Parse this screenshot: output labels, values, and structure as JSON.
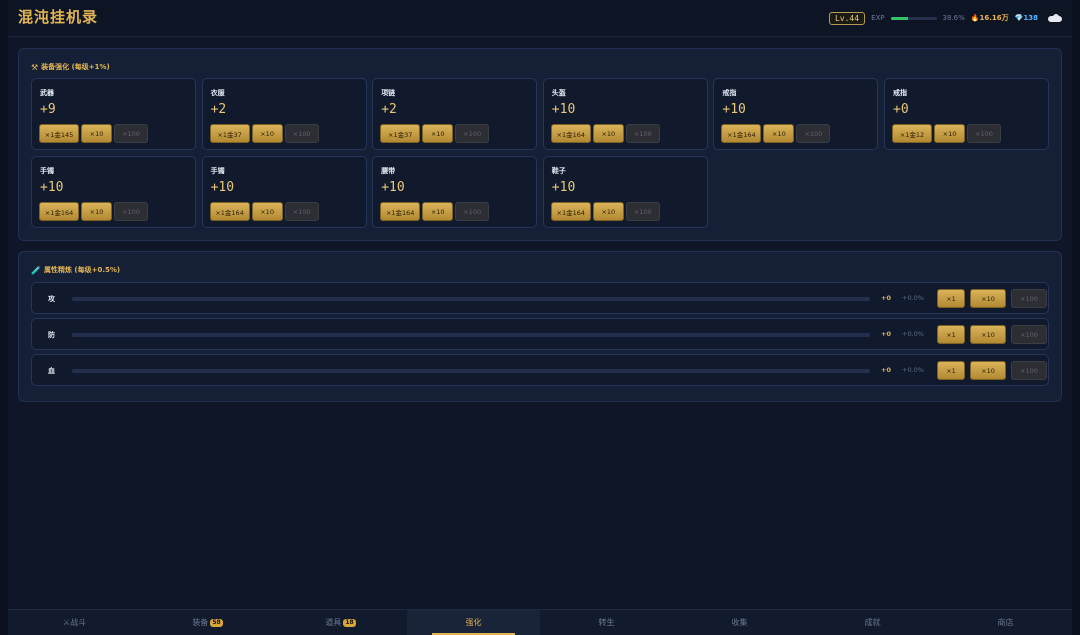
{
  "app": {
    "title": "混沌挂机录"
  },
  "header": {
    "level": "Lv.44",
    "exp_label": "EXP",
    "exp_progress": 0.386,
    "exp_pct": "38.6%",
    "gold": "16.16万",
    "gems": "138",
    "colors": {
      "accent": "#e2b554",
      "exp": "#34c36b",
      "gem": "#58b3ff"
    }
  },
  "equip": {
    "title": "装备强化 (每级+1%)",
    "icon": "hammer-pick-icon",
    "items": [
      {
        "name": "武器",
        "level": "+9",
        "b1": "×1金145",
        "b2": "×10",
        "b3": "×100"
      },
      {
        "name": "衣服",
        "level": "+2",
        "b1": "×1金37",
        "b2": "×10",
        "b3": "×100"
      },
      {
        "name": "项链",
        "level": "+2",
        "b1": "×1金37",
        "b2": "×10",
        "b3": "×100"
      },
      {
        "name": "头盔",
        "level": "+10",
        "b1": "×1金164",
        "b2": "×10",
        "b3": "×100"
      },
      {
        "name": "戒指",
        "level": "+10",
        "b1": "×1金164",
        "b2": "×10",
        "b3": "×100"
      },
      {
        "name": "戒指",
        "level": "+0",
        "b1": "×1金12",
        "b2": "×10",
        "b3": "×100"
      },
      {
        "name": "手镯",
        "level": "+10",
        "b1": "×1金164",
        "b2": "×10",
        "b3": "×100"
      },
      {
        "name": "手镯",
        "level": "+10",
        "b1": "×1金164",
        "b2": "×10",
        "b3": "×100"
      },
      {
        "name": "腰带",
        "level": "+10",
        "b1": "×1金164",
        "b2": "×10",
        "b3": "×100"
      },
      {
        "name": "鞋子",
        "level": "+10",
        "b1": "×1金164",
        "b2": "×10",
        "b3": "×100"
      }
    ]
  },
  "attrs": {
    "title": "属性精炼 (每级+0.5%)",
    "icon": "potion-icon",
    "rows": [
      {
        "name": "攻",
        "progress": 0,
        "plus": "+0",
        "pct": "+0.0%",
        "b1": "×1",
        "b2": "×10",
        "b3": "×100"
      },
      {
        "name": "防",
        "progress": 0,
        "plus": "+0",
        "pct": "+0.0%",
        "b1": "×1",
        "b2": "×10",
        "b3": "×100"
      },
      {
        "name": "血",
        "progress": 0,
        "plus": "+0",
        "pct": "+0.0%",
        "b1": "×1",
        "b2": "×10",
        "b3": "×100"
      }
    ]
  },
  "nav": [
    {
      "label": "⚔战斗",
      "badge": ""
    },
    {
      "label": "装备",
      "badge": "58"
    },
    {
      "label": "道具",
      "badge": "18"
    },
    {
      "label": "强化",
      "badge": "",
      "active": true
    },
    {
      "label": "转生",
      "badge": ""
    },
    {
      "label": "收集",
      "badge": ""
    },
    {
      "label": "成就",
      "badge": ""
    },
    {
      "label": "商店",
      "badge": ""
    }
  ]
}
